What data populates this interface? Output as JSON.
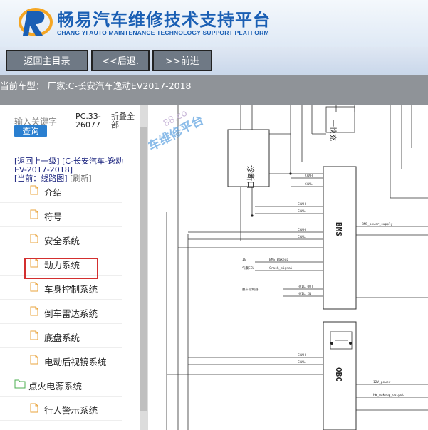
{
  "header": {
    "title": "畅易汽车维修技术支持平台",
    "subtitle": "CHANG YI AUTO MAINTENANCE TECHNOLOGY SUPPORT PLATFORM"
  },
  "toolbar": {
    "home_label": "返回主目录",
    "back_label": "<<后退.",
    "forward_label": ">>前进"
  },
  "car_bar": {
    "text": "当前车型：  厂家:C-长安汽车逸动EV2017-2018"
  },
  "left_panel": {
    "search_hint": "输入关键字",
    "query_label": "查询",
    "pc_code": "PC.33-26077",
    "fold_label": "折叠全部",
    "crumb_back": "[返回上一级]",
    "crumb_model": "[C-长安汽车-逸动EV-2017-2018]",
    "crumb_current": "[当前：线路图]",
    "crumb_refresh": "[刷新]"
  },
  "tree": [
    {
      "label": "介绍",
      "type": "file"
    },
    {
      "label": "符号",
      "type": "file"
    },
    {
      "label": "安全系统",
      "type": "file"
    },
    {
      "label": "动力系统",
      "type": "file"
    },
    {
      "label": "车身控制系统",
      "type": "file"
    },
    {
      "label": "倒车雷达系统",
      "type": "file"
    },
    {
      "label": "底盘系统",
      "type": "file"
    },
    {
      "label": "电动后视镜系统",
      "type": "file"
    },
    {
      "label": "点火电源系统",
      "type": "folder"
    },
    {
      "label": "行人警示系统",
      "type": "file"
    }
  ],
  "diagram": {
    "labels": {
      "diag_port": "诊断口",
      "bms": "BMS",
      "obc": "OBC",
      "watermark": "车维修平台",
      "can_h": "CANH",
      "can_l": "CANL",
      "bms_power": "BMS_power_supply",
      "bms_wakeup": "BMS_Wakeup",
      "crash": "Crash_signal",
      "hvil_out": "HVIL_OUT",
      "hvil_in": "HVIL_IN",
      "v12_power": "12V_power",
      "hw_wakeup": "HW_wakeup_output",
      "chg": "一快充",
      "wm_num": "88.co",
      "prefix_ig": "IG",
      "prefix_airbag": "气囊ECU",
      "prefix_vcu": "整车控制器"
    }
  },
  "colors": {
    "brand_blue": "#1a5fb4",
    "button_gray": "#6f7985",
    "highlight_red": "#d32f2f",
    "query_blue": "#2a7fd0",
    "watermark_blue": "#5aa0e0"
  }
}
